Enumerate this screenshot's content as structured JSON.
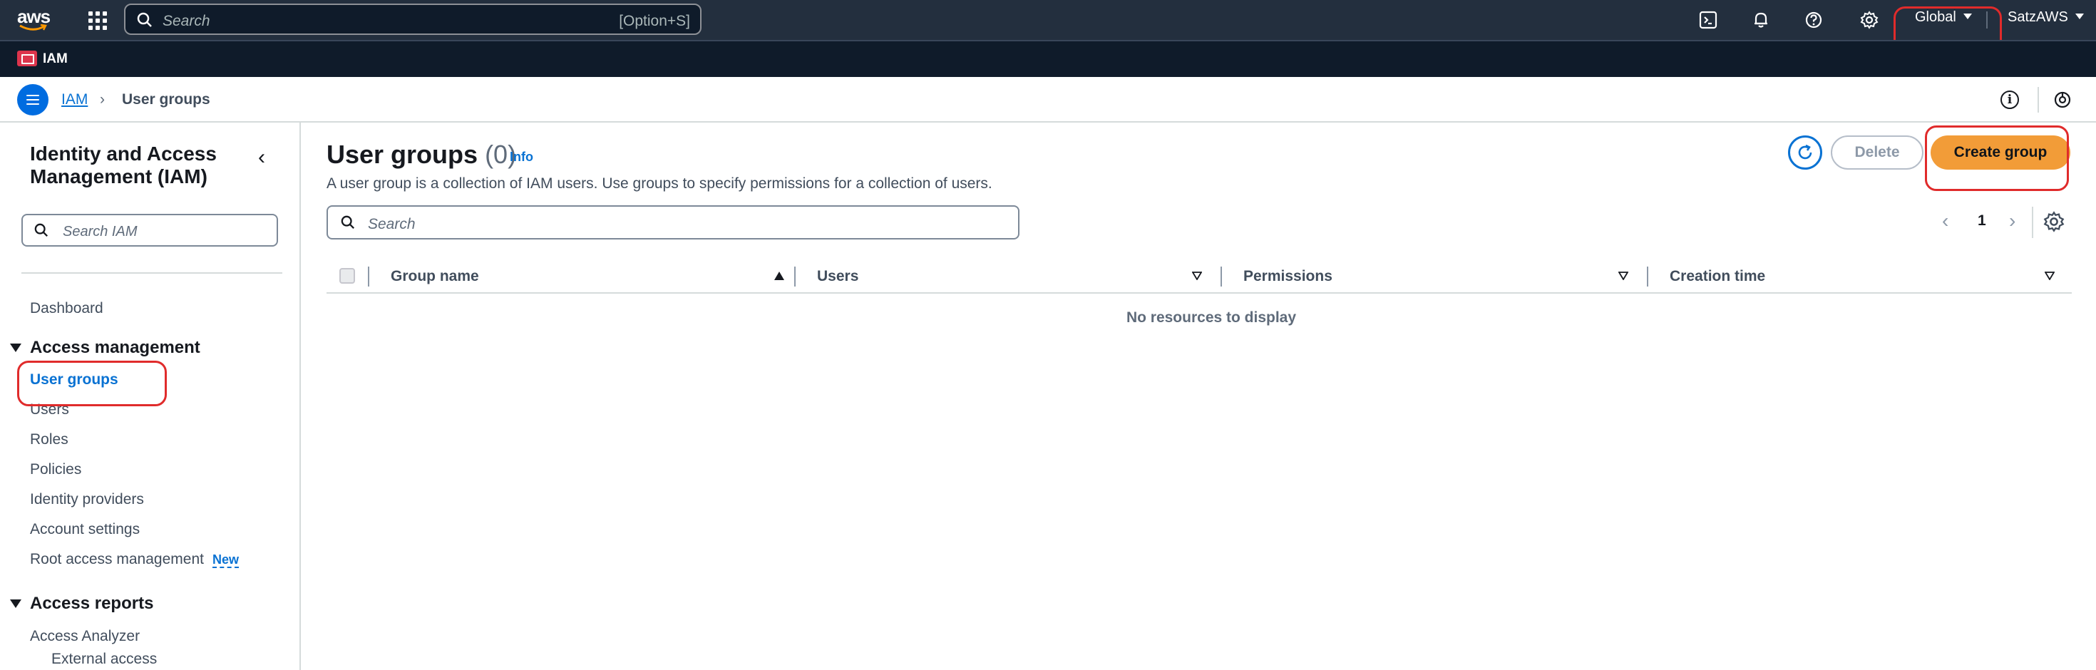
{
  "topnav": {
    "logo": "aws",
    "search_placeholder": "Search",
    "search_shortcut": "[Option+S]",
    "region": "Global",
    "account": "SatzAWS",
    "icons": [
      "cloudshell-icon",
      "bell-icon",
      "help-icon",
      "gear-icon"
    ]
  },
  "servicebar": {
    "label": "IAM"
  },
  "breadcrumb": {
    "root": "IAM",
    "separator": "›",
    "current": "User groups",
    "info": "i"
  },
  "sidebar": {
    "title": "Identity and Access Management (IAM)",
    "close": "‹",
    "search_placeholder": "Search IAM",
    "dashboard": "Dashboard",
    "access_management": {
      "heading": "Access management",
      "items": [
        "User groups",
        "Users",
        "Roles",
        "Policies",
        "Identity providers",
        "Account settings",
        "Root access management"
      ],
      "new_badge": "New"
    },
    "access_reports": {
      "heading": "Access reports",
      "items": [
        "Access Analyzer"
      ],
      "sub_items": [
        "External access"
      ]
    }
  },
  "main": {
    "title": "User groups",
    "count": "(0)",
    "info": "Info",
    "description": "A user group is a collection of IAM users. Use groups to specify permissions for a collection of users.",
    "buttons": {
      "delete": "Delete",
      "create": "Create group"
    },
    "search_placeholder": "Search",
    "pager": {
      "prev": "‹",
      "page": "1",
      "next": "›"
    },
    "table": {
      "columns": [
        "Group name",
        "Users",
        "Permissions",
        "Creation time"
      ],
      "empty_message": "No resources to display"
    }
  },
  "colors": {
    "topnav_bg": "#232f3e",
    "link": "#0972d3",
    "primary_button": "#f29c38",
    "annotation": "#e02b2b"
  }
}
